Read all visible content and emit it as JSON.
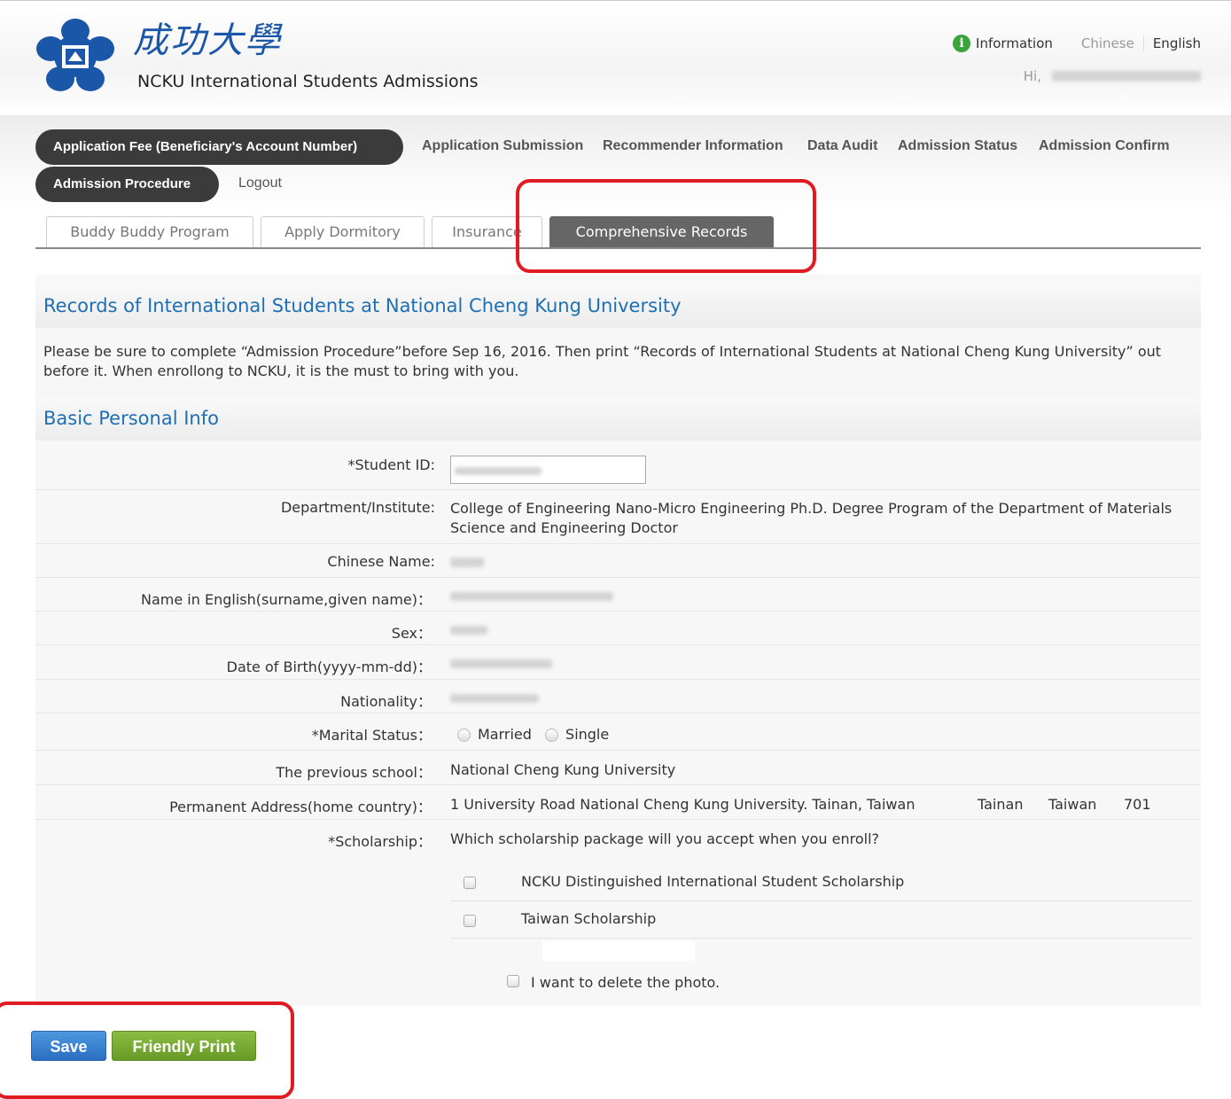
{
  "header": {
    "logo_text": "成功大學",
    "site_name": "NCKU International Students Admissions",
    "info_label": "Information",
    "lang_chinese": "Chinese",
    "lang_english": "English",
    "greeting": "Hi,"
  },
  "nav": {
    "items": [
      {
        "label": "Application Fee (Beneficiary's Account Number)"
      },
      {
        "label": "Application Submission"
      },
      {
        "label": "Recommender Information"
      },
      {
        "label": "Data Audit"
      },
      {
        "label": "Admission Status"
      },
      {
        "label": "Admission Confirm"
      },
      {
        "label": "Admission Procedure"
      },
      {
        "label": "Logout"
      }
    ]
  },
  "tabs": [
    {
      "label": "Buddy Buddy Program"
    },
    {
      "label": "Apply Dormitory"
    },
    {
      "label": "Insurance"
    },
    {
      "label": "Comprehensive Records",
      "active": true
    }
  ],
  "page": {
    "title": "Records of International Students at National Cheng Kung University",
    "notice": "Please be sure to complete “Admission Procedure”before Sep 16, 2016. Then print “Records of International Students at National Cheng Kung University” out before it. When enrollong to NCKU, it is the must to bring with you.",
    "section_basic": "Basic Personal Info"
  },
  "form": {
    "student_id_label": "*Student ID:",
    "department_label": "Department/Institute:",
    "department_value": "College of Engineering Nano-Micro Engineering Ph.D. Degree Program of the Department of Materials Science and Engineering Doctor",
    "chinese_name_label": "Chinese Name:",
    "english_name_label": "Name in English(surname,given name)：",
    "sex_label": "Sex：",
    "dob_label": "Date of Birth(yyyy-mm-dd)：",
    "nationality_label": "Nationality：",
    "marital_label": "*Marital Status：",
    "marital_options": [
      "Married",
      "Single"
    ],
    "previous_school_label": "The previous school：",
    "previous_school_value": "National Cheng Kung University",
    "address_label": "Permanent Address(home country)：",
    "address_value": "1 University Road National Cheng Kung University. Tainan, Taiwan",
    "address_city": "Tainan",
    "address_country": "Taiwan",
    "address_zip": "701",
    "scholarship_label": "*Scholarship：",
    "scholarship_question": "Which scholarship package will you accept when you enroll?",
    "scholarship_options": [
      "NCKU Distinguished International Student Scholarship",
      "Taiwan Scholarship"
    ],
    "delete_photo_label": "I want to delete the photo."
  },
  "buttons": {
    "save": "Save",
    "print": "Friendly Print"
  },
  "colors": {
    "highlight": "#e01b22",
    "link_blue": "#1f6fb5",
    "nav_pill": "#3b3b3b",
    "save_button": "#2a6fc2",
    "print_button": "#669a25"
  }
}
